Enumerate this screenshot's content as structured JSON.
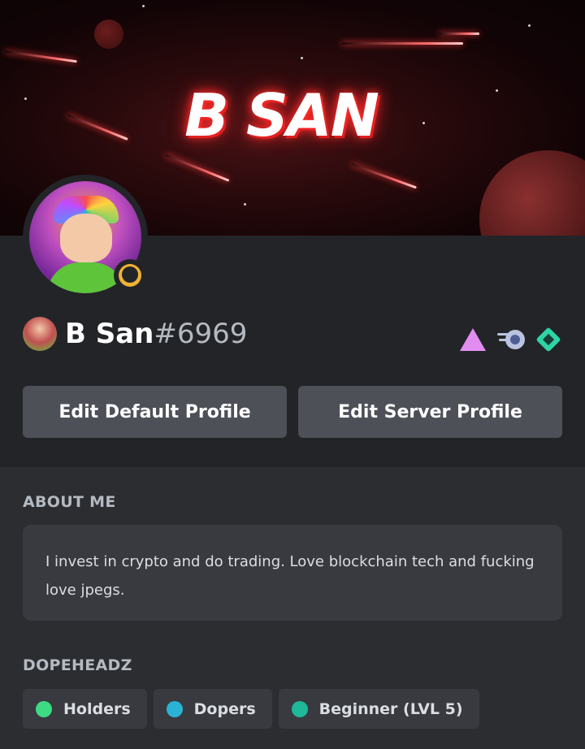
{
  "banner": {
    "title": "B SAN"
  },
  "user": {
    "name": "B San",
    "discriminator": "#6969",
    "status": "idle"
  },
  "badges": [
    {
      "icon": "hypesquad-balance-triangle-icon",
      "color": "#e38cf0"
    },
    {
      "icon": "nitro-boost-icon",
      "color": "#b9c3e0"
    },
    {
      "icon": "hypesquad-diamond-icon",
      "color": "#2dd4a6"
    }
  ],
  "buttons": {
    "edit_default": "Edit Default Profile",
    "edit_server": "Edit Server Profile"
  },
  "about": {
    "label": "ABOUT ME",
    "text": "I invest in crypto and do trading. Love blockchain tech and fucking love jpegs."
  },
  "roles": {
    "label": "DOPEHEADZ",
    "items": [
      {
        "name": "Holders",
        "color": "#3ddc84"
      },
      {
        "name": "Dopers",
        "color": "#2bb3d6"
      },
      {
        "name": "Beginner (LVL 5)",
        "color": "#1fb899"
      }
    ]
  }
}
